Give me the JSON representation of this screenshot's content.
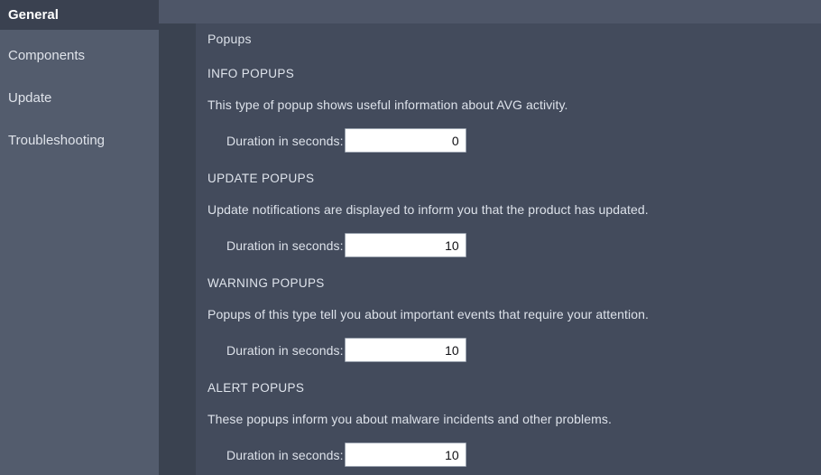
{
  "sidebar": {
    "items": [
      {
        "label": "General",
        "active": true
      },
      {
        "label": "Components",
        "active": false
      },
      {
        "label": "Update",
        "active": false
      },
      {
        "label": "Troubleshooting",
        "active": false
      }
    ]
  },
  "panel": {
    "title": "Popups",
    "sections": [
      {
        "heading": "INFO POPUPS",
        "description": "This type of popup shows useful information about AVG activity.",
        "duration_label": "Duration in seconds:",
        "duration_value": "0"
      },
      {
        "heading": "UPDATE POPUPS",
        "description": "Update notifications are displayed to inform you that the product has updated.",
        "duration_label": "Duration in seconds:",
        "duration_value": "10"
      },
      {
        "heading": "WARNING POPUPS",
        "description": "Popups of this type tell you about important events that require your attention.",
        "duration_label": "Duration in seconds:",
        "duration_value": "10"
      },
      {
        "heading": "ALERT POPUPS",
        "description": "These popups inform you about malware incidents and other problems.",
        "duration_label": "Duration in seconds:",
        "duration_value": "10"
      }
    ]
  },
  "colors": {
    "sidebar_bg": "#535c6d",
    "sidebar_active_bg": "#3a4150",
    "gap_bg": "#3a4250",
    "panel_bg": "#434b5c",
    "top_strip_bg": "#4e5668",
    "text": "#dde2ea",
    "input_bg": "#ffffff",
    "input_text": "#101014"
  }
}
